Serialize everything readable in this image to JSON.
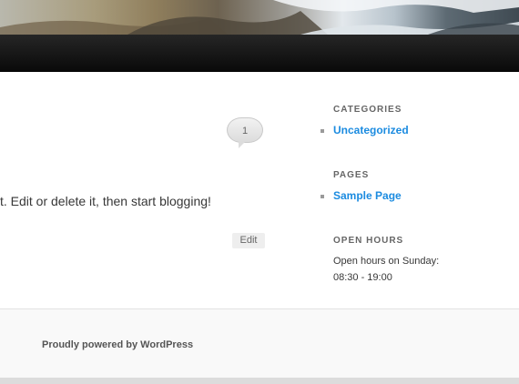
{
  "header": {
    "image_alt": ""
  },
  "post": {
    "comment_count": "1",
    "excerpt": "t. Edit or delete it, then start blogging!",
    "edit_label": "Edit"
  },
  "sidebar": {
    "categories": {
      "title": "CATEGORIES",
      "items": [
        "Uncategorized"
      ]
    },
    "pages": {
      "title": "PAGES",
      "items": [
        "Sample Page"
      ]
    },
    "open_hours": {
      "title": "OPEN HOURS",
      "line1": "Open hours on Sunday:",
      "line2": "08:30 - 19:00"
    }
  },
  "footer": {
    "credit": "Proudly powered by WordPress"
  },
  "colors": {
    "link": "#1b8be0",
    "navbar": "#111111",
    "footer_bg": "#f9f9f9"
  }
}
